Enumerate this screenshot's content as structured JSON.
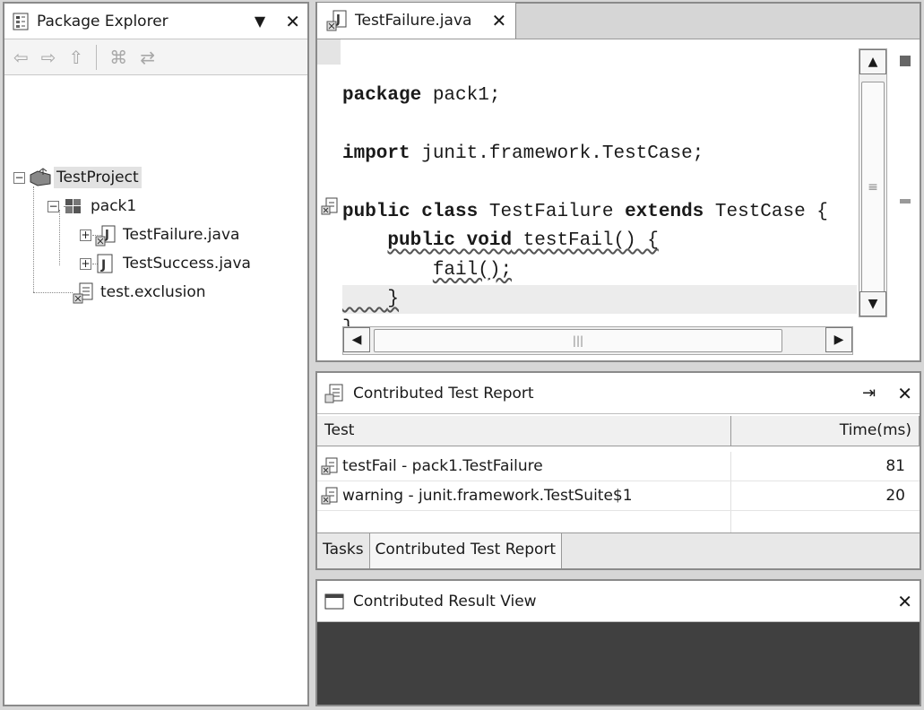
{
  "package_explorer": {
    "title": "Package Explorer",
    "tree": [
      {
        "label": "TestProject",
        "expander": "−"
      },
      {
        "label": "pack1",
        "expander": "−"
      },
      {
        "label": "TestFailure.java",
        "expander": "+"
      },
      {
        "label": "TestSuccess.java",
        "expander": "+"
      },
      {
        "label": "test.exclusion",
        "expander": ""
      }
    ]
  },
  "editor": {
    "tab_label": "TestFailure.java",
    "lines": [
      {
        "kw": "package",
        "rest": " pack1;"
      },
      {
        "kw": "",
        "rest": ""
      },
      {
        "kw": "import",
        "rest": " junit.framework.TestCase;"
      },
      {
        "kw": "",
        "rest": ""
      },
      {
        "kw": "public class",
        "rest": " TestFailure ",
        "kw2": "extends",
        "rest2": " TestCase {"
      },
      {
        "pre": "    ",
        "kw": "public void",
        "rest": " testFail() {"
      },
      {
        "pre": "        ",
        "kw": "",
        "rest": "fail();"
      },
      {
        "pre": "    ",
        "kw": "",
        "rest": "}"
      },
      {
        "kw": "",
        "rest": "}"
      }
    ]
  },
  "test_report": {
    "title": "Contributed Test Report",
    "columns": [
      "Test",
      "Time(ms)"
    ],
    "rows": [
      {
        "name": "testFail - pack1.TestFailure",
        "time": "81"
      },
      {
        "name": "warning - junit.framework.TestSuite$1",
        "time": "20"
      }
    ],
    "tabs": [
      "Tasks",
      "Contributed Test Report"
    ]
  },
  "result_view": {
    "title": "Contributed Result View"
  }
}
